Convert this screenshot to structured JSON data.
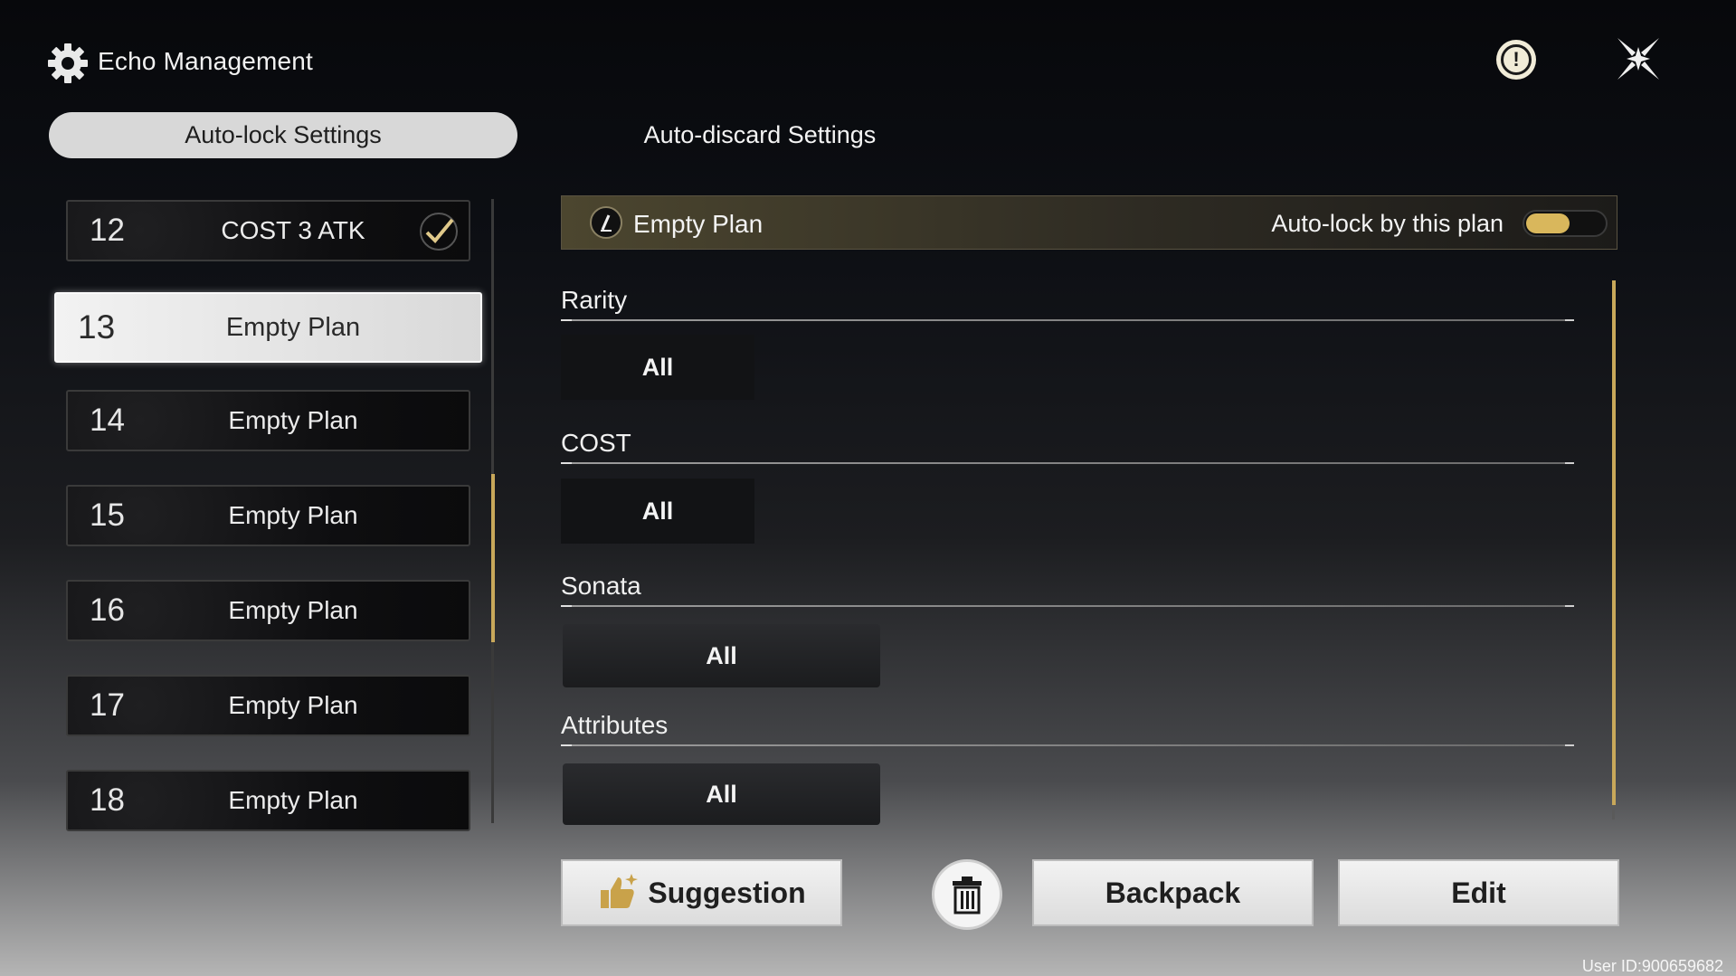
{
  "header": {
    "title": "Echo Management"
  },
  "tabs": [
    {
      "label": "Auto-lock Settings",
      "active": true
    },
    {
      "label": "Auto-discard Settings",
      "active": false
    }
  ],
  "plans": [
    {
      "num": "12",
      "label": "COST 3 ATK"
    },
    {
      "num": "13",
      "label": "Empty Plan"
    },
    {
      "num": "14",
      "label": "Empty Plan"
    },
    {
      "num": "15",
      "label": "Empty Plan"
    },
    {
      "num": "16",
      "label": "Empty Plan"
    },
    {
      "num": "17",
      "label": "Empty Plan"
    },
    {
      "num": "18",
      "label": "Empty Plan"
    }
  ],
  "selected_plan_index": 1,
  "plan_detail": {
    "title": "Empty Plan",
    "autolock_label": "Auto-lock by this plan",
    "autolock_on": true,
    "sections": [
      {
        "title": "Rarity",
        "value": "All"
      },
      {
        "title": "COST",
        "value": "All"
      },
      {
        "title": "Sonata",
        "value": "All"
      },
      {
        "title": "Attributes",
        "value": "All"
      }
    ]
  },
  "buttons": {
    "suggestion": "Suggestion",
    "backpack": "Backpack",
    "edit": "Edit"
  },
  "user_id": "User ID:900659682",
  "colors": {
    "accent": "#d9b75c",
    "active_tab": "#d8d8d8"
  },
  "icons": [
    "gear-icon",
    "alert-icon",
    "close-icon",
    "checkmark-icon",
    "pencil-icon",
    "thumbs-up-icon",
    "trash-icon"
  ]
}
